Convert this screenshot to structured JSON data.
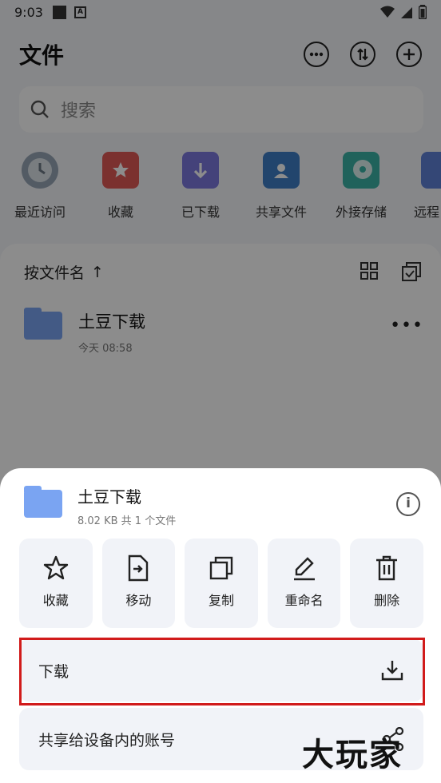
{
  "status_bar": {
    "time": "9:03",
    "battery_text": "▮"
  },
  "header": {
    "title": "文件"
  },
  "search": {
    "placeholder": "搜索"
  },
  "quick_access": [
    {
      "label": "最近访问",
      "icon": "clock-icon",
      "color": "#98a6b6"
    },
    {
      "label": "收藏",
      "icon": "star-icon",
      "color": "#e15a57"
    },
    {
      "label": "已下载",
      "icon": "download-icon",
      "color": "#7c79df"
    },
    {
      "label": "共享文件",
      "icon": "shared-folder-icon",
      "color": "#3f7ec6"
    },
    {
      "label": "外接存储",
      "icon": "disk-icon",
      "color": "#3bb2a6"
    },
    {
      "label": "远程",
      "icon": "remote-icon",
      "color": "#5f82d8"
    }
  ],
  "file_list": {
    "sort_label": "按文件名",
    "sort_arrow": "↑",
    "files": [
      {
        "name": "土豆下载",
        "time": "今天 08:58"
      }
    ]
  },
  "sheet": {
    "name": "土豆下载",
    "info": "8.02 KB 共 1 个文件",
    "actions": [
      {
        "label": "收藏",
        "icon": "star-icon"
      },
      {
        "label": "移动",
        "icon": "move-icon"
      },
      {
        "label": "复制",
        "icon": "copy-icon"
      },
      {
        "label": "重命名",
        "icon": "pen-icon"
      },
      {
        "label": "删除",
        "icon": "trash-icon"
      }
    ],
    "download_label": "下载",
    "share_label": "共享给设备内的账号"
  },
  "watermark": "大玩家",
  "colors": {
    "folder": "#7aa4f2",
    "highlight": "#d11b1b"
  }
}
